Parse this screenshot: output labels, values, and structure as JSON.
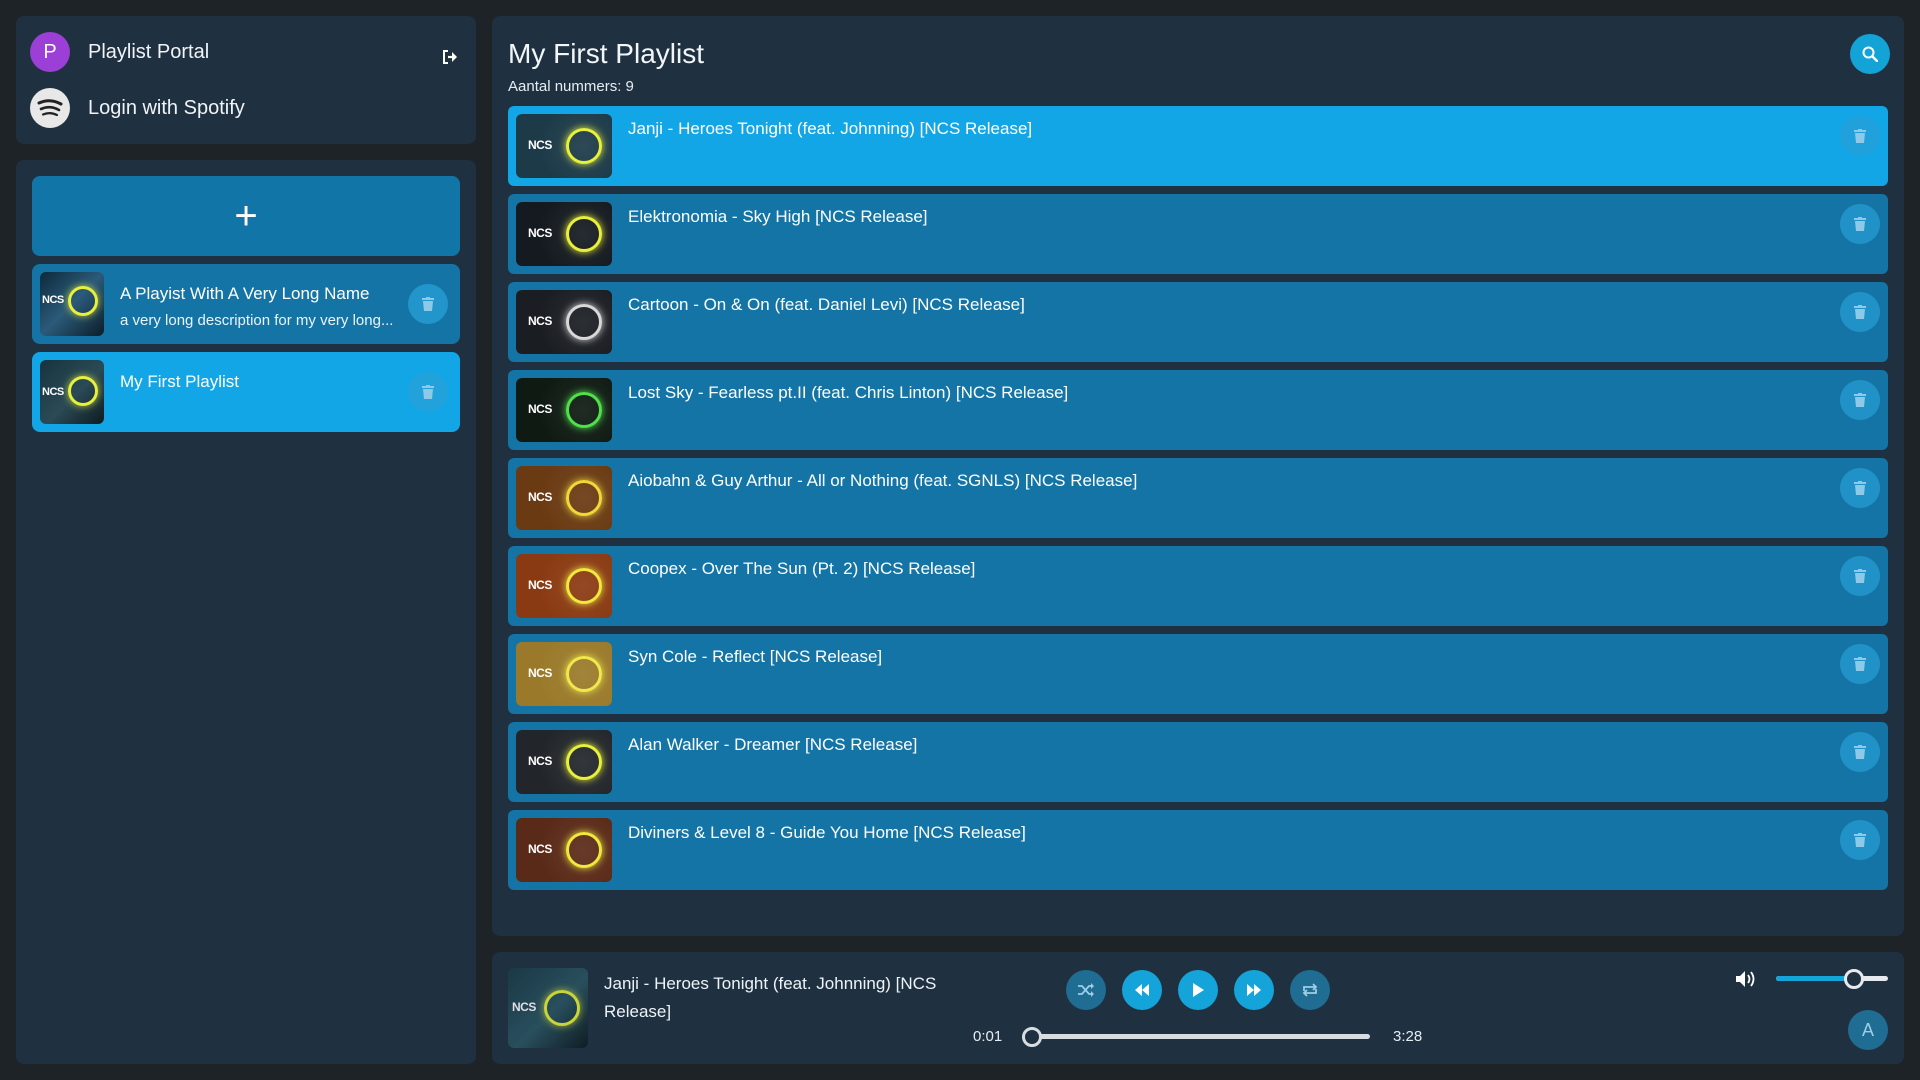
{
  "user": {
    "avatar_letter": "P",
    "name": "Playlist Portal",
    "spotify_label": "Login with Spotify"
  },
  "sidebar": {
    "add_label": "+",
    "playlists": [
      {
        "title": "A Playist With A Very Long Name",
        "description": "a very long description for my very long...",
        "active": false
      },
      {
        "title": "My First Playlist",
        "description": "",
        "active": true
      }
    ]
  },
  "main": {
    "title": "My First Playlist",
    "count_text": "Aantal nummers: 9",
    "tracks": [
      {
        "title": "Janji - Heroes Tonight (feat. Johnning) [NCS Release]",
        "ring": "#e8f03a",
        "bg": "#1c3a48",
        "active": true
      },
      {
        "title": "Elektronomia - Sky High [NCS Release]",
        "ring": "#e8f03a",
        "bg": "#151a20",
        "active": false
      },
      {
        "title": "Cartoon - On & On (feat. Daniel Levi) [NCS Release]",
        "ring": "#d8d8d8",
        "bg": "#1a1d22",
        "active": false
      },
      {
        "title": "Lost Sky - Fearless pt.II (feat. Chris Linton) [NCS Release]",
        "ring": "#4fe04a",
        "bg": "#0e1a12",
        "active": false
      },
      {
        "title": "Aiobahn & Guy Arthur - All or Nothing (feat. SGNLS) [NCS Release]",
        "ring": "#f0d83a",
        "bg": "#6a3a12",
        "active": false
      },
      {
        "title": "Coopex - Over The Sun (Pt. 2) [NCS Release]",
        "ring": "#f0e83a",
        "bg": "#8a3a12",
        "active": false
      },
      {
        "title": "Syn Cole - Reflect [NCS Release]",
        "ring": "#f0e84a",
        "bg": "#9a7a2a",
        "active": false
      },
      {
        "title": "Alan Walker - Dreamer [NCS Release]",
        "ring": "#e8f03a",
        "bg": "#22262a",
        "active": false
      },
      {
        "title": "Diviners & Level 8 - Guide You Home [NCS Release]",
        "ring": "#f0e83a",
        "bg": "#5a2a18",
        "active": false
      }
    ]
  },
  "player": {
    "now_playing": "Janji - Heroes Tonight (feat. Johnning) [NCS Release]",
    "current_time": "0:01",
    "duration": "3:28",
    "progress_fraction": 0.005,
    "volume_fraction": 0.7,
    "mode_label": "A"
  },
  "colors": {
    "panel": "#1f3140",
    "item": "#1374a5",
    "item_active": "#12a6e6",
    "accent": "#14a4d9",
    "avatar": "#9b3fd6"
  },
  "icons": {
    "logout": "logout-icon",
    "search": "search-icon",
    "delete": "trash-icon",
    "shuffle": "shuffle-icon",
    "rewind": "rewind-icon",
    "play": "play-icon",
    "forward": "fast-forward-icon",
    "repeat": "repeat-icon",
    "volume": "volume-icon"
  }
}
